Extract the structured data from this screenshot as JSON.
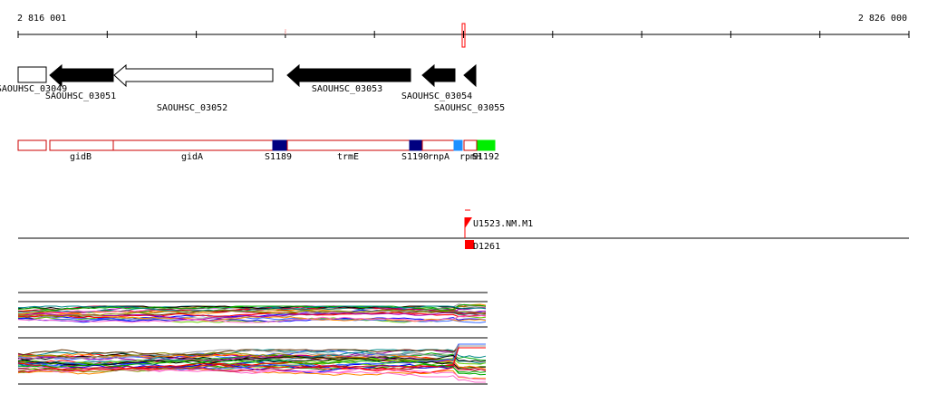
{
  "ruler": {
    "start_label": "2 816 001",
    "end_label": "2 826 000"
  },
  "genes": [
    {
      "label": "SAOUHSC_03049",
      "strand": "+",
      "fill": "white"
    },
    {
      "label": "SAOUHSC_03051",
      "strand": "-",
      "fill": "black"
    },
    {
      "label": "SAOUHSC_03052",
      "strand": "-",
      "fill": "white"
    },
    {
      "label": "SAOUHSC_03053",
      "strand": "-",
      "fill": "black"
    },
    {
      "label": "SAOUHSC_03054",
      "strand": "-",
      "fill": "black"
    },
    {
      "label": "SAOUHSC_03055",
      "strand": "-",
      "fill": "black"
    }
  ],
  "features": [
    {
      "label": "gidB"
    },
    {
      "label": "gidA"
    },
    {
      "label": "S1189"
    },
    {
      "label": "trmE"
    },
    {
      "label": "S1190"
    },
    {
      "label": "rnpA"
    },
    {
      "label": "rpmH"
    },
    {
      "label": "S1192"
    }
  ],
  "markers": {
    "upper_label": "U1523.NM.M1",
    "lower_label": "D1261"
  },
  "colors": {
    "gene_fill_dark": "#000000",
    "feature_border": "#cc0000",
    "srna_dark": "#000080",
    "srna_light": "#1e90ff",
    "srna_green": "#00ee00",
    "marker_red": "#ff0000",
    "highlight_pink": "#ffaaaa"
  }
}
